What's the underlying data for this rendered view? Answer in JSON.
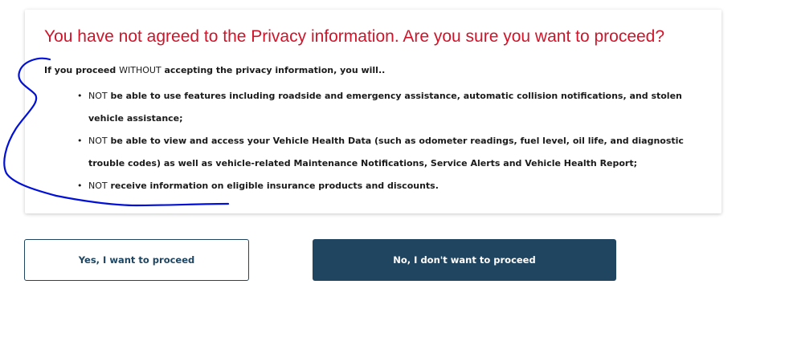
{
  "dialog": {
    "title": "You have not agreed to the Privacy information. Are you sure you want to proceed?",
    "intro_part1": "If you proceed ",
    "intro_without": "WITHOUT",
    "intro_part2": " accepting the privacy information, you will..",
    "bullets": [
      {
        "prefix": "NOT",
        "text": " be able to use features including roadside and emergency assistance, automatic collision notifications, and stolen vehicle assistance;"
      },
      {
        "prefix": "NOT",
        "text": " be able to view and access your Vehicle Health Data (such as odometer readings, fuel level, oil life, and diagnostic trouble codes) as well as vehicle-related Maintenance Notifications, Service Alerts and Vehicle Health Report;"
      },
      {
        "prefix": "NOT",
        "text": " receive information on eligible insurance products and discounts."
      }
    ]
  },
  "actions": {
    "yes_label": "Yes, I want to proceed",
    "no_label": "No, I don't want to proceed"
  },
  "colors": {
    "title_red": "#d0152b",
    "primary_navy": "#1f4560",
    "annotation_blue": "#0010d8"
  }
}
